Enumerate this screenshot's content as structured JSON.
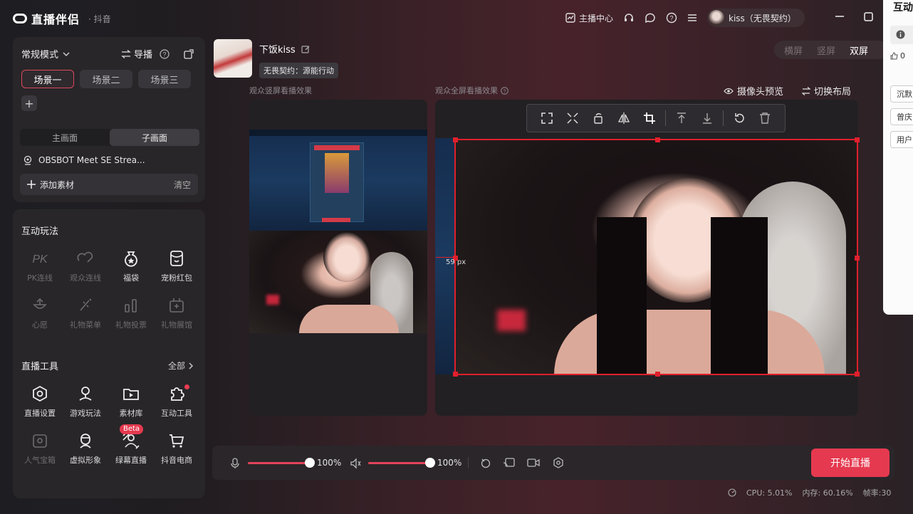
{
  "app": {
    "title": "直播伴侣",
    "subtitle": "· 抖音"
  },
  "topbar": {
    "anchor_center": "主播中心",
    "user_name": "kiss（无畏契约）"
  },
  "left": {
    "mode": "常规模式",
    "guide": "导播",
    "scenes": [
      "场景一",
      "场景二",
      "场景三"
    ],
    "plus": "+",
    "tabs": [
      "主画面",
      "子画面"
    ],
    "source": "OBSBOT Meet SE Strea...",
    "add_material": "添加素材",
    "clear": "清空",
    "interactive_title": "互动玩法",
    "interactive": [
      {
        "label": "PK连线",
        "icon": "pk-icon",
        "dim": true
      },
      {
        "label": "观众连线",
        "icon": "audience-link-icon",
        "dim": true
      },
      {
        "label": "福袋",
        "icon": "lucky-bag-icon",
        "dim": false
      },
      {
        "label": "宠粉红包",
        "icon": "red-packet-icon",
        "dim": false
      },
      {
        "label": "心愿",
        "icon": "wish-icon",
        "dim": true
      },
      {
        "label": "礼物菜单",
        "icon": "gift-menu-icon",
        "dim": true
      },
      {
        "label": "礼物投票",
        "icon": "gift-vote-icon",
        "dim": true
      },
      {
        "label": "礼物展馆",
        "icon": "gift-hall-icon",
        "dim": true
      }
    ],
    "tools_title": "直播工具",
    "all": "全部",
    "tools": [
      {
        "label": "直播设置",
        "icon": "live-settings-icon",
        "dim": false
      },
      {
        "label": "游戏玩法",
        "icon": "game-play-icon",
        "dim": false
      },
      {
        "label": "素材库",
        "icon": "material-library-icon",
        "dim": false
      },
      {
        "label": "互动工具",
        "icon": "interactive-tools-icon",
        "dim": false
      },
      {
        "label": "人气宝箱",
        "icon": "popularity-box-icon",
        "dim": true
      },
      {
        "label": "虚拟形象",
        "icon": "avatar-icon",
        "dim": false
      },
      {
        "label": "绿幕直播",
        "icon": "green-screen-icon",
        "dim": false
      },
      {
        "label": "抖音电商",
        "icon": "ecommerce-icon",
        "dim": false
      }
    ],
    "beta": "Beta"
  },
  "streamer": {
    "name": "下饭kiss",
    "tag": "无畏契约：源能行动"
  },
  "orientation": {
    "options": [
      "横屏",
      "竖屏",
      "双屏"
    ],
    "selected": "双屏"
  },
  "preview": {
    "vertical_label": "观众竖屏看播效果",
    "fullscreen_label": "观众全屏看播效果",
    "camera_preview": "摄像头预览",
    "switch_layout": "切换布局",
    "distance": "59 px"
  },
  "bottom": {
    "mic_volume": "100%",
    "speaker_volume": "100%",
    "mic_level": 1.0,
    "speaker_level": 1.0,
    "start": "开始直播"
  },
  "status": {
    "cpu": "CPU: 5.01%",
    "mem": "内存: 60.16%",
    "fps": "帧率:30"
  },
  "side_panel": {
    "title": "互动",
    "likes": "0",
    "buttons": [
      "沉默",
      "曾庆",
      "用户"
    ]
  }
}
